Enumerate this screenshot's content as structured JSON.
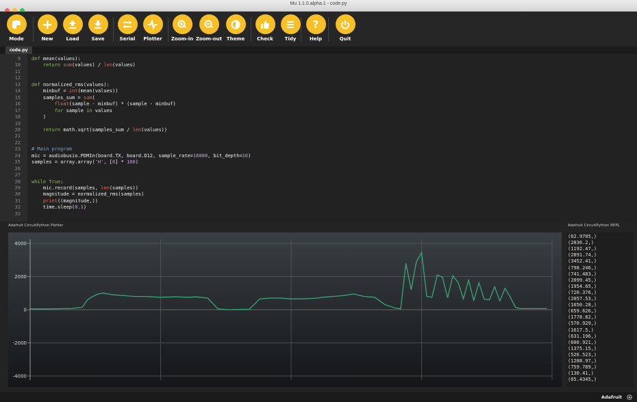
{
  "window": {
    "title": "Mu 1.1.0.alpha.1 - code.py"
  },
  "toolbar": [
    {
      "key": "mode",
      "label": "Mode"
    },
    {
      "key": "new",
      "label": "New"
    },
    {
      "key": "load",
      "label": "Load"
    },
    {
      "key": "save",
      "label": "Save"
    },
    {
      "key": "serial",
      "label": "Serial"
    },
    {
      "key": "plotter",
      "label": "Plotter"
    },
    {
      "key": "zoom-in",
      "label": "Zoom-in"
    },
    {
      "key": "zoom-out",
      "label": "Zoom-out"
    },
    {
      "key": "theme",
      "label": "Theme"
    },
    {
      "key": "check",
      "label": "Check"
    },
    {
      "key": "tidy",
      "label": "Tidy"
    },
    {
      "key": "help",
      "label": "Help"
    },
    {
      "key": "quit",
      "label": "Quit"
    }
  ],
  "tabs": [
    {
      "label": "code.py"
    }
  ],
  "colors": {
    "accent": "#f6c026",
    "plot_line": "#38a872",
    "keyword": "#8abf4c",
    "builtin": "#e06c5a",
    "string_number": "#c9a0dc",
    "comment": "#7a9fc8",
    "plain": "#f0f0f0"
  },
  "editor": {
    "lines": [
      {
        "num": "9",
        "segments": [
          {
            "t": "def",
            "c": "kw"
          },
          {
            "t": " mean(values):",
            "c": "p"
          }
        ]
      },
      {
        "num": "10",
        "segments": [
          {
            "t": "    return",
            "c": "kw"
          },
          {
            "t": " ",
            "c": "p"
          },
          {
            "t": "sum",
            "c": "bi"
          },
          {
            "t": "(values) / ",
            "c": "p"
          },
          {
            "t": "len",
            "c": "bi"
          },
          {
            "t": "(values)",
            "c": "p"
          }
        ]
      },
      {
        "num": "11",
        "segments": []
      },
      {
        "num": "12",
        "segments": []
      },
      {
        "num": "13",
        "segments": [
          {
            "t": "def",
            "c": "kw"
          },
          {
            "t": " normalized_rms(values):",
            "c": "p"
          }
        ]
      },
      {
        "num": "14",
        "segments": [
          {
            "t": "    minbuf = ",
            "c": "p"
          },
          {
            "t": "int",
            "c": "bi"
          },
          {
            "t": "(mean(values))",
            "c": "p"
          }
        ]
      },
      {
        "num": "15",
        "segments": [
          {
            "t": "    samples_sum = ",
            "c": "p"
          },
          {
            "t": "sum",
            "c": "bi"
          },
          {
            "t": "(",
            "c": "p"
          }
        ]
      },
      {
        "num": "16",
        "segments": [
          {
            "t": "        ",
            "c": "p"
          },
          {
            "t": "float",
            "c": "bi"
          },
          {
            "t": "(sample - minbuf) * (sample - minbuf)",
            "c": "p"
          }
        ]
      },
      {
        "num": "17",
        "segments": [
          {
            "t": "        for",
            "c": "kw"
          },
          {
            "t": " sample ",
            "c": "p"
          },
          {
            "t": "in",
            "c": "kw"
          },
          {
            "t": " values",
            "c": "p"
          }
        ]
      },
      {
        "num": "18",
        "segments": [
          {
            "t": "    )",
            "c": "p"
          }
        ]
      },
      {
        "num": "19",
        "segments": []
      },
      {
        "num": "20",
        "segments": [
          {
            "t": "    return",
            "c": "kw"
          },
          {
            "t": " math.sqrt(samples_sum / ",
            "c": "p"
          },
          {
            "t": "len",
            "c": "bi"
          },
          {
            "t": "(values))",
            "c": "p"
          }
        ]
      },
      {
        "num": "21",
        "segments": []
      },
      {
        "num": "22",
        "segments": []
      },
      {
        "num": "23",
        "segments": [
          {
            "t": "# Main program",
            "c": "cm"
          }
        ]
      },
      {
        "num": "24",
        "segments": [
          {
            "t": "mic = audiobusio.PDMIn(board.TX, board.D12, sample_rate=",
            "c": "p"
          },
          {
            "t": "16000",
            "c": "st"
          },
          {
            "t": ", bit_depth=",
            "c": "p"
          },
          {
            "t": "16",
            "c": "st"
          },
          {
            "t": ")",
            "c": "p"
          }
        ]
      },
      {
        "num": "25",
        "segments": [
          {
            "t": "samples = array.array(",
            "c": "p"
          },
          {
            "t": "'H'",
            "c": "st"
          },
          {
            "t": ", [",
            "c": "p"
          },
          {
            "t": "0",
            "c": "st"
          },
          {
            "t": "] * ",
            "c": "p"
          },
          {
            "t": "160",
            "c": "st"
          },
          {
            "t": ")",
            "c": "p"
          }
        ]
      },
      {
        "num": "26",
        "segments": []
      },
      {
        "num": "27",
        "segments": []
      },
      {
        "num": "28",
        "segments": [
          {
            "t": "while",
            "c": "kw"
          },
          {
            "t": " ",
            "c": "p"
          },
          {
            "t": "True",
            "c": "kw"
          },
          {
            "t": ":",
            "c": "p"
          }
        ]
      },
      {
        "num": "29",
        "segments": [
          {
            "t": "    mic.record(samples, ",
            "c": "p"
          },
          {
            "t": "len",
            "c": "bi"
          },
          {
            "t": "(samples))",
            "c": "p"
          }
        ]
      },
      {
        "num": "30",
        "segments": [
          {
            "t": "    magnitude = normalized_rms(samples)",
            "c": "p"
          }
        ]
      },
      {
        "num": "31",
        "segments": [
          {
            "t": "    ",
            "c": "p"
          },
          {
            "t": "print",
            "c": "bi"
          },
          {
            "t": "((magnitude,))",
            "c": "p"
          }
        ]
      },
      {
        "num": "32",
        "segments": [
          {
            "t": "    time.sleep(",
            "c": "p"
          },
          {
            "t": "0.1",
            "c": "st"
          },
          {
            "t": ")",
            "c": "p"
          }
        ]
      },
      {
        "num": "33",
        "segments": []
      }
    ]
  },
  "plotter": {
    "title": "Adafruit CircuitPython Plotter"
  },
  "repl": {
    "title": "Adafruit CircuitPython REPL",
    "lines": [
      "(62.9705,)",
      "(2836.2,)",
      "(1192.47,)",
      "(2891.74,)",
      "(3452.41,)",
      "(798.246,)",
      "(741.483,)",
      "(2099.45,)",
      "(1954.65,)",
      "(720.376,)",
      "(2057.53,)",
      "(1650.28,)",
      "(659.626,)",
      "(1778.82,)",
      "(570.929,)",
      "(1617.5,)",
      "(631.196,)",
      "(600.921,)",
      "(1375.15,)",
      "(526.523,)",
      "(1288.97,)",
      "(759.789,)",
      "(130.41,)",
      "(65.4345,)"
    ]
  },
  "status": {
    "mode_label": "Adafruit"
  },
  "chart_data": {
    "type": "line",
    "yticks": [
      4000,
      2000,
      0,
      -2000,
      -4000
    ],
    "ylim": [
      -4000,
      4000
    ],
    "xlim": [
      0,
      100
    ],
    "grid": true,
    "series": [
      {
        "x": [
          0,
          2,
          4,
          6,
          8,
          10,
          11,
          12,
          13,
          14,
          15,
          16,
          18,
          20,
          22,
          25,
          28,
          30,
          32,
          34,
          36,
          38,
          40,
          42,
          44,
          46,
          48,
          50,
          52,
          54,
          55,
          56,
          58,
          60,
          62,
          64,
          66,
          68,
          70,
          71,
          72,
          73,
          74,
          75,
          76,
          77,
          78,
          79,
          80,
          81,
          82,
          83,
          84,
          85,
          86,
          87,
          88,
          89,
          90,
          91,
          92,
          93,
          94,
          95,
          96,
          97,
          98,
          99
        ],
        "y": [
          50,
          50,
          50,
          60,
          80,
          150,
          600,
          800,
          950,
          1000,
          950,
          900,
          850,
          800,
          800,
          750,
          780,
          750,
          770,
          700,
          50,
          0,
          20,
          30,
          650,
          700,
          700,
          650,
          650,
          680,
          700,
          750,
          800,
          850,
          950,
          800,
          750,
          300,
          100,
          50,
          2800,
          1200,
          2900,
          3450,
          800,
          750,
          2100,
          1950,
          720,
          2050,
          1650,
          660,
          1780,
          570,
          1620,
          630,
          600,
          1380,
          530,
          1290,
          760,
          130,
          65,
          65,
          65,
          65,
          65,
          65
        ]
      }
    ]
  }
}
